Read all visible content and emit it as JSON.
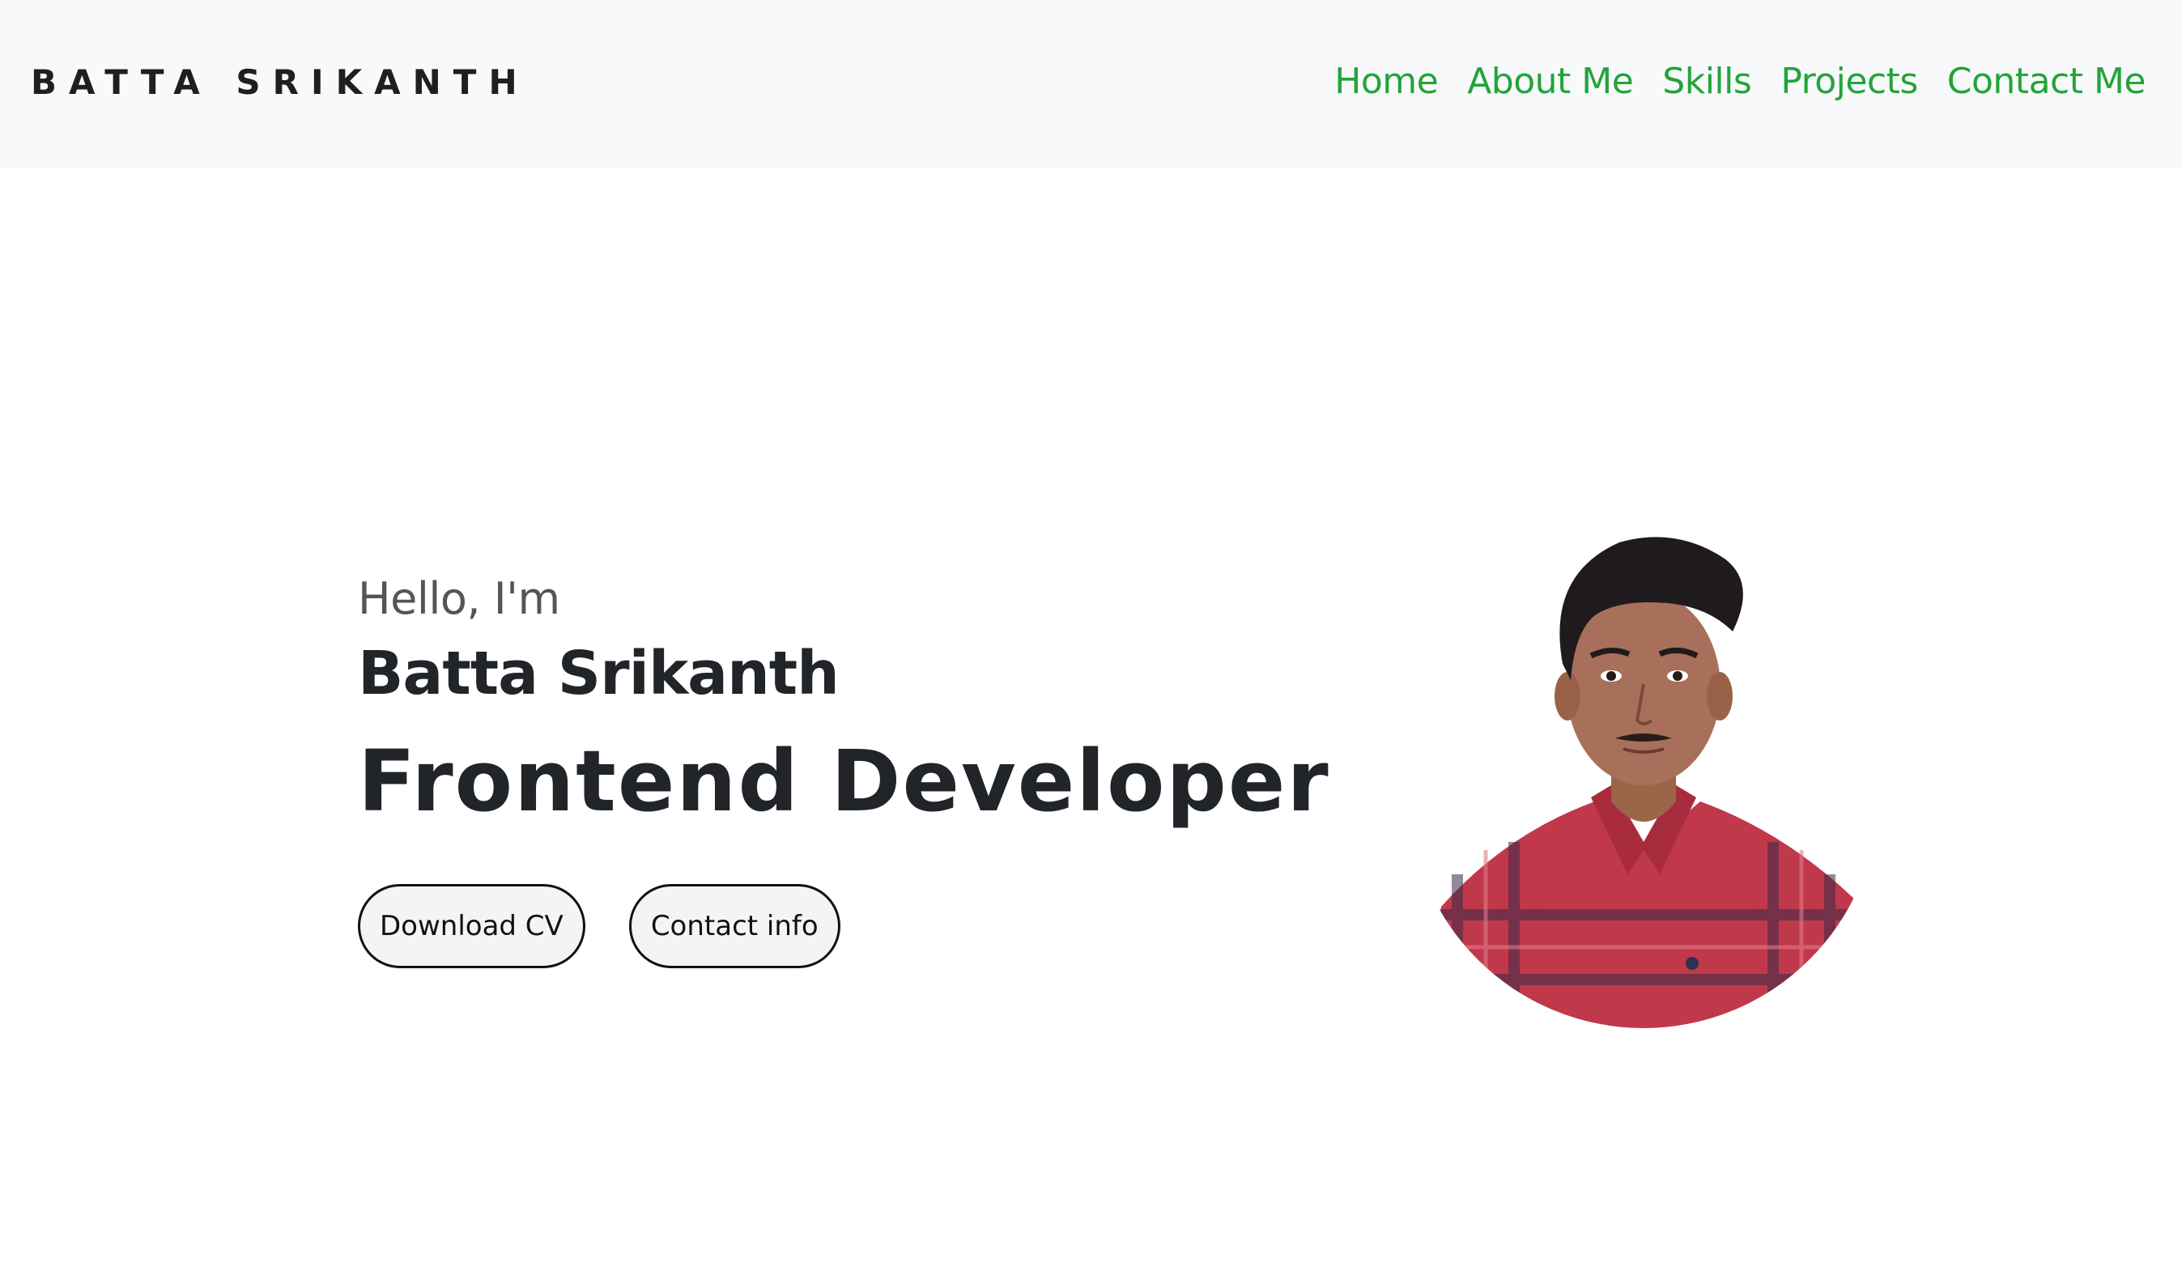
{
  "navbar": {
    "brand": "BATTA SRIKANTH",
    "links": [
      "Home",
      "About Me",
      "Skills",
      "Projects",
      "Contact Me"
    ]
  },
  "hero": {
    "greeting": "Hello, I'm",
    "name": "Batta Srikanth",
    "role": "Frontend Developer",
    "buttons": {
      "download": "Download CV",
      "contact": "Contact info"
    }
  },
  "colors": {
    "nav_background": "#f8f9fa",
    "nav_link": "#22a43a",
    "text_dark": "#212529",
    "shirt": "#c0394b"
  },
  "icons": {
    "profile_photo": "person-portrait"
  }
}
